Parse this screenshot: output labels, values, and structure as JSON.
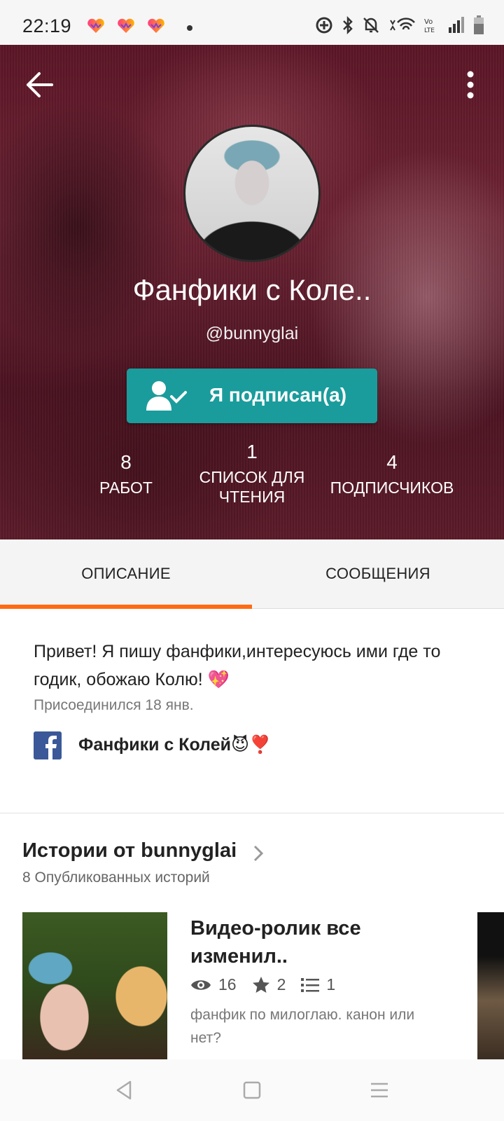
{
  "status_bar": {
    "time": "22:19",
    "app_icons": [
      "heart-app-icon",
      "heart-app-icon",
      "heart-app-icon"
    ],
    "system_icons": [
      "sync-icon",
      "bluetooth-icon",
      "bell-off-icon",
      "wifi-icon",
      "volte-icon",
      "signal-icon",
      "battery-icon"
    ]
  },
  "profile": {
    "name": "Фанфики с Коле..",
    "handle": "@bunnyglai",
    "follow_label": "Я подписан(а)",
    "stats": [
      {
        "num": "8",
        "label": "РАБОТ"
      },
      {
        "num": "1",
        "label": "СПИСОК ДЛЯ ЧТЕНИЯ"
      },
      {
        "num": "4",
        "label": "ПОДПИСЧИКОВ"
      }
    ]
  },
  "tabs": [
    {
      "label": "ОПИСАНИЕ",
      "active": true
    },
    {
      "label": "СООБЩЕНИЯ",
      "active": false
    }
  ],
  "about": {
    "bio": "Привет! Я пишу фанфики,интересуюсь ими где то годик, обожаю Колю! 💖",
    "joined": "Присоединился 18 янв.",
    "facebook_link": "Фанфики с Колей😈❣️"
  },
  "stories": {
    "title": "Истории от bunnyglai",
    "count_text": "8 Опубликованных историй",
    "items": [
      {
        "title": "Видео-ролик все изменил..",
        "views": "16",
        "votes": "2",
        "parts": "1",
        "description": "фанфик по милоглаю. канон или нет?"
      }
    ]
  },
  "colors": {
    "accent": "#ff6b12",
    "follow_button": "#1a9c9c",
    "facebook": "#3b5998"
  }
}
